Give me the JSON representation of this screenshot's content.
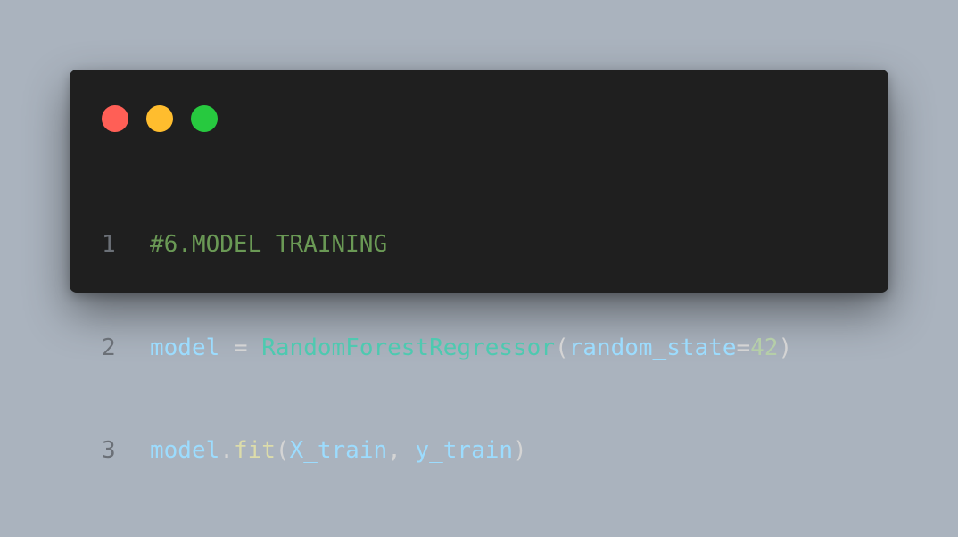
{
  "window": {
    "controls": [
      {
        "name": "close",
        "color": "#ff5f56"
      },
      {
        "name": "minimize",
        "color": "#ffbd2e"
      },
      {
        "name": "maximize",
        "color": "#27c93f"
      }
    ]
  },
  "code": {
    "lines": [
      {
        "number": "1",
        "tokens": [
          {
            "text": "#6.MODEL TRAINING",
            "type": "comment"
          }
        ]
      },
      {
        "number": "2",
        "tokens": [
          {
            "text": "model",
            "type": "var"
          },
          {
            "text": " = ",
            "type": "op"
          },
          {
            "text": "RandomForestRegressor",
            "type": "class"
          },
          {
            "text": "(",
            "type": "paren"
          },
          {
            "text": "random_state",
            "type": "var"
          },
          {
            "text": "=",
            "type": "op"
          },
          {
            "text": "42",
            "type": "num"
          },
          {
            "text": ")",
            "type": "paren"
          }
        ]
      },
      {
        "number": "3",
        "tokens": [
          {
            "text": "model",
            "type": "var"
          },
          {
            "text": ".",
            "type": "punct"
          },
          {
            "text": "fit",
            "type": "fn"
          },
          {
            "text": "(",
            "type": "paren"
          },
          {
            "text": "X_train",
            "type": "var"
          },
          {
            "text": ", ",
            "type": "punct"
          },
          {
            "text": "y_train",
            "type": "var"
          },
          {
            "text": ")",
            "type": "paren"
          }
        ]
      }
    ]
  }
}
